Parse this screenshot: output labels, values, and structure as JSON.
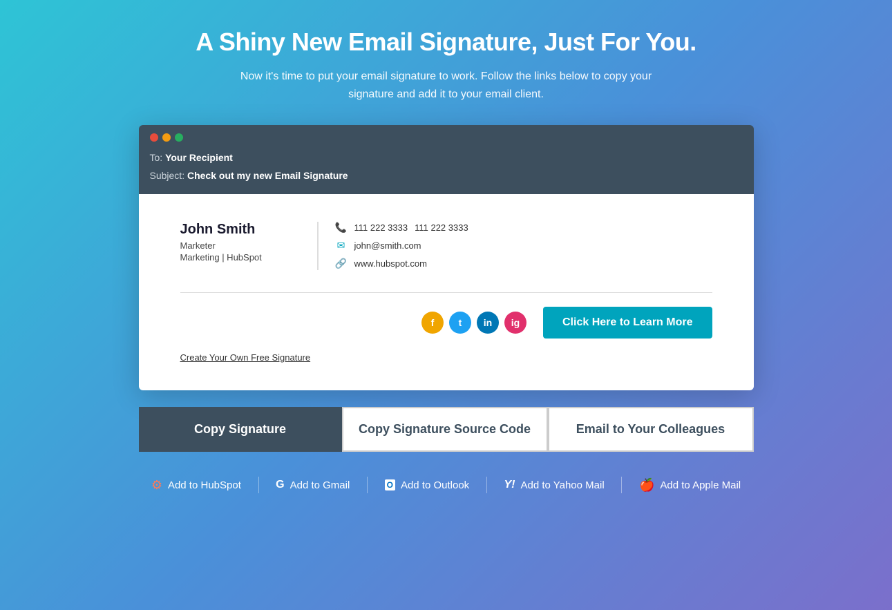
{
  "page": {
    "title": "A Shiny New Email Signature, Just For You.",
    "subtitle": "Now it's time to put your email signature to work. Follow the links below to copy your signature and add it to your email client."
  },
  "email": {
    "to_label": "To:",
    "to_value": "Your Recipient",
    "subject_label": "Subject:",
    "subject_value": "Check out my new Email Signature"
  },
  "signature": {
    "name": "John Smith",
    "title": "Marketer",
    "company": "Marketing | HubSpot",
    "phone1": "111 222 3333",
    "phone2": "111 222 3333",
    "email": "john@smith.com",
    "website": "www.hubspot.com",
    "cta_label": "Click Here to Learn More",
    "free_link": "Create Your Own Free Signature"
  },
  "actions": {
    "copy_sig": "Copy Signature",
    "copy_source": "Copy Signature Source Code",
    "email_colleagues": "Email to Your Colleagues"
  },
  "add_to": {
    "hubspot": "Add to HubSpot",
    "gmail": "Add to Gmail",
    "outlook": "Add to Outlook",
    "yahoo": "Add to Yahoo Mail",
    "apple": "Add to Apple Mail"
  },
  "social": {
    "facebook": "f",
    "twitter": "t",
    "linkedin": "in",
    "instagram": "ig"
  }
}
